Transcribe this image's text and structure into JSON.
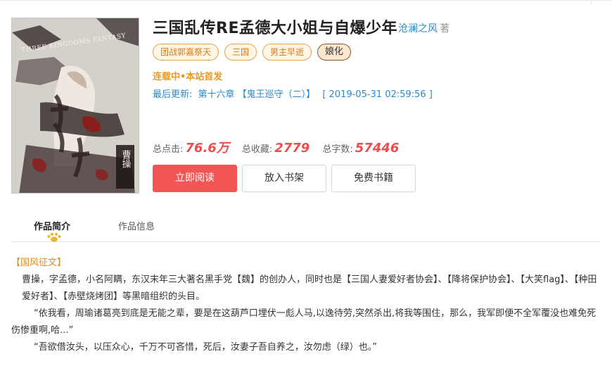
{
  "book": {
    "title": "三国乱传RE孟德大小姐与自爆少年",
    "author": "沧澜之风",
    "author_suffix": "著",
    "tags": [
      "团战郭嘉祭天",
      "三国",
      "男主早逝",
      "娘化"
    ],
    "status": "连载中•本站首发",
    "update_label": "最后更新:",
    "update_chapter": "第十六章 【鬼王巡守（二）】",
    "update_time": "[ 2019-05-31 02:59:56 ]"
  },
  "cover": {
    "title_text": "THREE KINGDOMS FANTASY",
    "author_glyphs": "曹操",
    "colors": {
      "bg": "#d7d4cf",
      "ink": "#3a2a2a",
      "accent": "#8c1d1d"
    }
  },
  "stats": {
    "clicks_label": "总点击:",
    "clicks_value": "76.6万",
    "favorites_label": "总收藏:",
    "favorites_value": "2779",
    "words_label": "总字数:",
    "words_value": "57446"
  },
  "actions": {
    "read": "立即阅读",
    "shelf": "放入书架",
    "free": "免费书籍"
  },
  "tabs": {
    "intro": "作品简介",
    "info": "作品信息"
  },
  "intro": {
    "heading": "【国风征文】",
    "p1": "曹操，字孟德，小名阿瞒，东汉末年三大著名黑手党【魏】的创办人，同时也是【三国人妻爱好者协会】、【降将保护协会】、【大笑flag】、【种田爱好者】、【赤壁烧烤团】等黑暗组织的头目。",
    "p2": "“依我看，周瑜诸葛亮到底是无能之辈，要是在这葫芦口埋伏一彪人马,以逸待劳,突然杀出,将我等围住，那么，我军即便不全军覆没也难免死伤惨重啊,哈...”",
    "p3": "“吾欲借汝头，以压众心，千万不可吝惜，死后，汝妻子吾自养之，汝勿虑（绿）也。”"
  },
  "colors": {
    "accent_red": "#f25555",
    "link_blue": "#2a8ac8",
    "tag_orange": "#e9a24b",
    "status_orange": "#e99a22"
  }
}
